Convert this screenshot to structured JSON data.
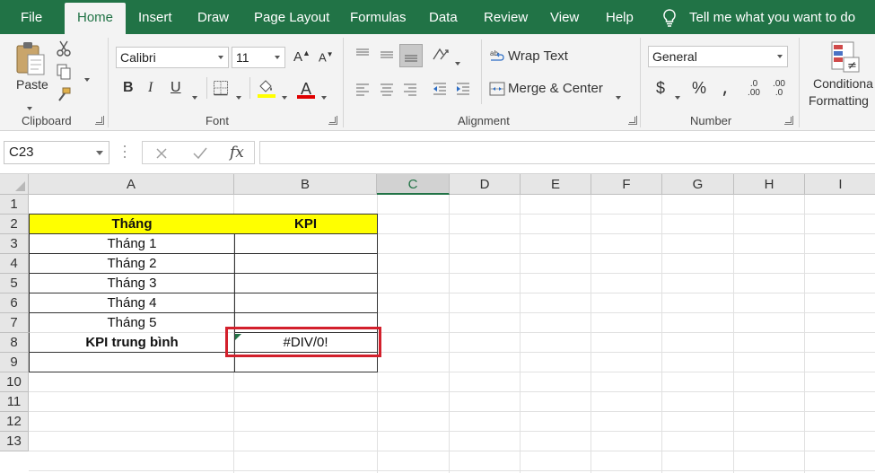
{
  "menu": {
    "tabs": [
      {
        "label": "File"
      },
      {
        "label": "Home"
      },
      {
        "label": "Insert"
      },
      {
        "label": "Draw"
      },
      {
        "label": "Page Layout"
      },
      {
        "label": "Formulas"
      },
      {
        "label": "Data"
      },
      {
        "label": "Review"
      },
      {
        "label": "View"
      },
      {
        "label": "Help"
      }
    ],
    "active_tab": "Home",
    "tell_me": "Tell me what you want to do"
  },
  "ribbon": {
    "clipboard": {
      "paste_label": "Paste",
      "group_label": "Clipboard"
    },
    "font": {
      "font_name": "Calibri",
      "font_size": "11",
      "bold": "B",
      "italic": "I",
      "underline": "U",
      "grow": "A",
      "shrink": "A",
      "font_color_letter": "A",
      "group_label": "Font"
    },
    "alignment": {
      "wrap_text": "Wrap Text",
      "merge_center": "Merge & Center",
      "group_label": "Alignment"
    },
    "number": {
      "format": "General",
      "currency": "$",
      "percent": "%",
      "group_label": "Number",
      "inc_decimal_top": ".0",
      "inc_decimal_bottom": ".00",
      "dec_decimal_top": ".00",
      "dec_decimal_bottom": ".0"
    },
    "styles": {
      "conditional_line1": "Conditiona",
      "conditional_line2": "Formatting"
    }
  },
  "formula_bar": {
    "name_box": "C23",
    "fx": "fx",
    "formula": ""
  },
  "sheet": {
    "columns": [
      "A",
      "B",
      "C",
      "D",
      "E",
      "F",
      "G",
      "H",
      "I"
    ],
    "selected_column": "C",
    "rows": [
      "1",
      "2",
      "3",
      "4",
      "5",
      "6",
      "7",
      "8",
      "9",
      "10",
      "11",
      "12",
      "13"
    ],
    "cells": {
      "A2": "Tháng",
      "B2": "KPI",
      "A3": "Tháng 1",
      "A4": "Tháng 2",
      "A5": "Tháng 3",
      "A6": "Tháng 4",
      "A7": "Tháng 5",
      "A8": "KPI trung bình",
      "B8": "#DIV/0!"
    }
  },
  "colors": {
    "excel_green": "#217346",
    "header_fill": "#ffff00",
    "highlight_box": "#d3202c"
  }
}
